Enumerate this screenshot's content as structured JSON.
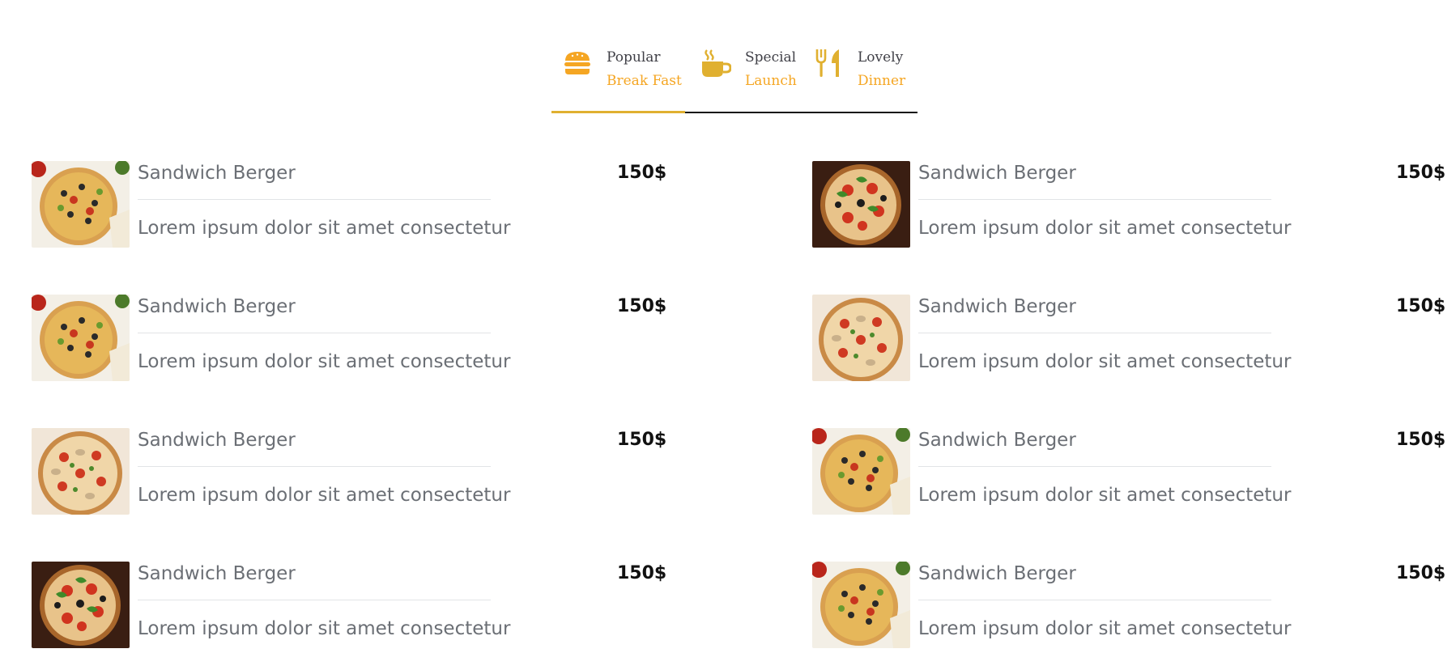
{
  "tabs": [
    {
      "sub": "Popular",
      "main": "Break Fast",
      "icon": "burger-icon"
    },
    {
      "sub": "Special",
      "main": "Launch",
      "icon": "coffee-cup-icon"
    },
    {
      "sub": "Lovely",
      "main": "Dinner",
      "icon": "fork-knife-icon"
    }
  ],
  "colors": {
    "accent": "#f5a623",
    "icon": "#e0b030",
    "text": "#6b6f75",
    "price": "#111111"
  },
  "menu": {
    "left": [
      {
        "name": "Sandwich Berger",
        "desc": "Lorem ipsum dolor sit amet consectetur",
        "price": "150$"
      },
      {
        "name": "Sandwich Berger",
        "desc": "Lorem ipsum dolor sit amet consectetur",
        "price": "150$"
      },
      {
        "name": "Sandwich Berger",
        "desc": "Lorem ipsum dolor sit amet consectetur",
        "price": "150$"
      },
      {
        "name": "Sandwich Berger",
        "desc": "Lorem ipsum dolor sit amet consectetur",
        "price": "150$"
      }
    ],
    "right": [
      {
        "name": "Sandwich Berger",
        "desc": "Lorem ipsum dolor sit amet consectetur",
        "price": "150$"
      },
      {
        "name": "Sandwich Berger",
        "desc": "Lorem ipsum dolor sit amet consectetur",
        "price": "150$"
      },
      {
        "name": "Sandwich Berger",
        "desc": "Lorem ipsum dolor sit amet consectetur",
        "price": "150$"
      },
      {
        "name": "Sandwich Berger",
        "desc": "Lorem ipsum dolor sit amet consectetur",
        "price": "150$"
      }
    ]
  }
}
